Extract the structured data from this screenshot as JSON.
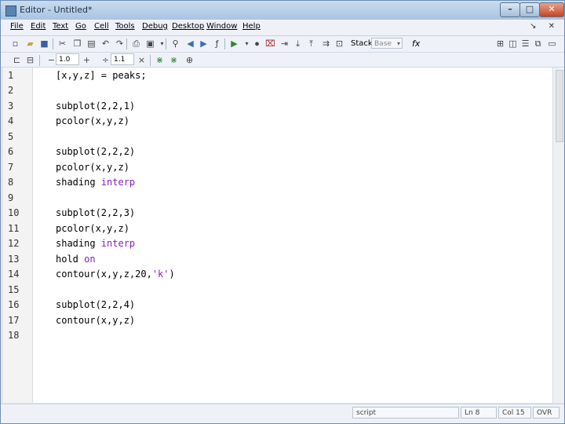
{
  "window": {
    "title": "Editor - Untitled*"
  },
  "menu": [
    "File",
    "Edit",
    "Text",
    "Go",
    "Cell",
    "Tools",
    "Debug",
    "Desktop",
    "Window",
    "Help"
  ],
  "toolbar": {
    "stack_label": "Stack:",
    "stack_value": "Base",
    "fx_label": "fx",
    "cell_step_minus": "−",
    "cell_value_1": "1.0",
    "cell_step_plus": "+",
    "cell_divide": "÷",
    "cell_value_2": "1.1",
    "cell_times": "×"
  },
  "editor": {
    "lines": [
      {
        "num": "1",
        "code": "[x,y,z] = peaks;"
      },
      {
        "num": "2",
        "code": ""
      },
      {
        "num": "3",
        "code": "subplot(2,2,1)"
      },
      {
        "num": "4",
        "code": "pcolor(x,y,z)"
      },
      {
        "num": "5",
        "code": ""
      },
      {
        "num": "6",
        "code": "subplot(2,2,2)"
      },
      {
        "num": "7",
        "code": "pcolor(x,y,z)"
      },
      {
        "num": "8",
        "code": "shading ",
        "kw": "interp"
      },
      {
        "num": "9",
        "code": ""
      },
      {
        "num": "10",
        "code": "subplot(2,2,3)"
      },
      {
        "num": "11",
        "code": "pcolor(x,y,z)"
      },
      {
        "num": "12",
        "code": "shading ",
        "kw": "interp"
      },
      {
        "num": "13",
        "code": "hold ",
        "kw": "on"
      },
      {
        "num": "14",
        "code": "contour(x,y,z,20,",
        "str": "'k'",
        "tail": ")"
      },
      {
        "num": "15",
        "code": ""
      },
      {
        "num": "16",
        "code": "subplot(2,2,4)"
      },
      {
        "num": "17",
        "code": "contour(x,y,z)"
      },
      {
        "num": "18",
        "code": ""
      }
    ]
  },
  "status": {
    "mode": "script",
    "line": "Ln 8",
    "col": "Col 15",
    "ovr": "OVR"
  },
  "colors": {
    "keyword": "#8a1fc0",
    "titlebar": "#a9c4e2"
  }
}
